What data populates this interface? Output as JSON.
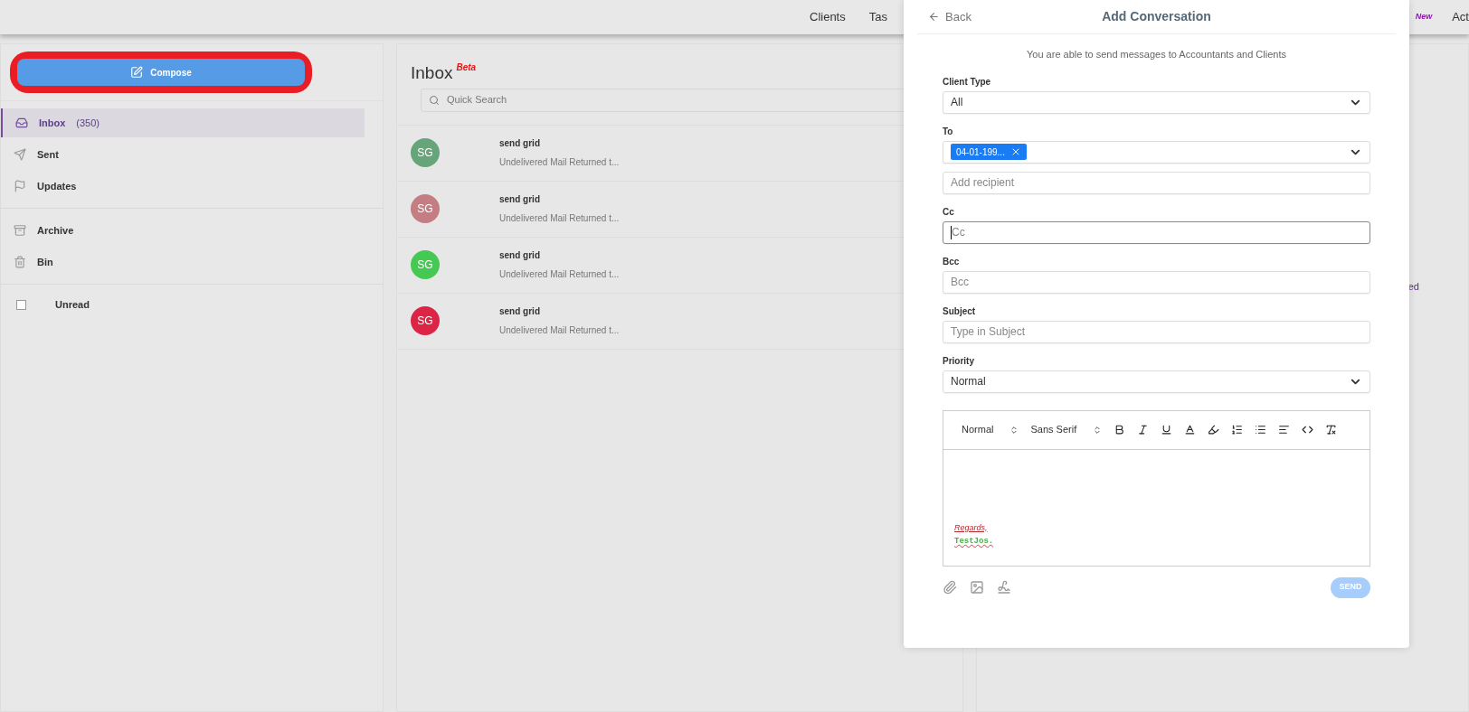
{
  "nav": {
    "items": [
      "Clients",
      "Tas"
    ],
    "new_badge": "New",
    "last_item": "Act"
  },
  "sidebar": {
    "compose": {
      "label": "Compose",
      "highlighted": true
    },
    "folder_groups": [
      [
        {
          "label": "Inbox",
          "count": "(350)",
          "selected": true
        },
        {
          "label": "Sent",
          "selected": false
        },
        {
          "label": "Updates",
          "selected": false
        }
      ],
      [
        {
          "label": "Archive",
          "selected": false
        },
        {
          "label": "Bin",
          "selected": false
        }
      ]
    ],
    "filter": {
      "label": "Unread",
      "checked": false
    }
  },
  "inbox": {
    "title": "Inbox",
    "badge": "Beta",
    "search": {
      "placeholder": "Quick Search"
    },
    "messages": [
      {
        "initials": "SG",
        "color": "#66a47a",
        "sender": "send grid",
        "preview": "Undelivered Mail Returned t..."
      },
      {
        "initials": "SG",
        "color": "#c47d82",
        "sender": "send grid",
        "preview": "Undelivered Mail Returned t..."
      },
      {
        "initials": "SG",
        "color": "#45c953",
        "sender": "send grid",
        "preview": "Undelivered Mail Returned t..."
      },
      {
        "initials": "SG",
        "color": "#dc2545",
        "sender": "send grid",
        "preview": "Undelivered Mail Returned t..."
      }
    ]
  },
  "right_pane": {
    "fragment": "ed"
  },
  "dialog": {
    "back": "Back",
    "title": "Add Conversation",
    "note": "You are able to send messages to Accountants and Clients",
    "fields": [
      {
        "kind": "select",
        "label": "Client Type",
        "value": "All"
      },
      {
        "kind": "tags",
        "label": "To",
        "tags": [
          "04-01-199..."
        ]
      },
      {
        "kind": "input",
        "placeholder": "Add recipient",
        "focused": false
      },
      {
        "kind": "input",
        "label": "Cc",
        "placeholder": "Cc",
        "focused": true
      },
      {
        "kind": "input",
        "label": "Bcc",
        "placeholder": "Bcc",
        "focused": false
      },
      {
        "kind": "input",
        "label": "Subject",
        "placeholder": "Type in Subject",
        "focused": false
      },
      {
        "kind": "select",
        "label": "Priority",
        "value": "Normal"
      }
    ],
    "editor": {
      "heading_select": "Normal",
      "font_select": "Sans Serif",
      "lines": [
        {
          "kind": "signoff",
          "text": "Regards,"
        },
        {
          "kind": "name",
          "text": "TestJos."
        }
      ]
    },
    "send": {
      "label": "SEND",
      "disabled": true
    }
  }
}
